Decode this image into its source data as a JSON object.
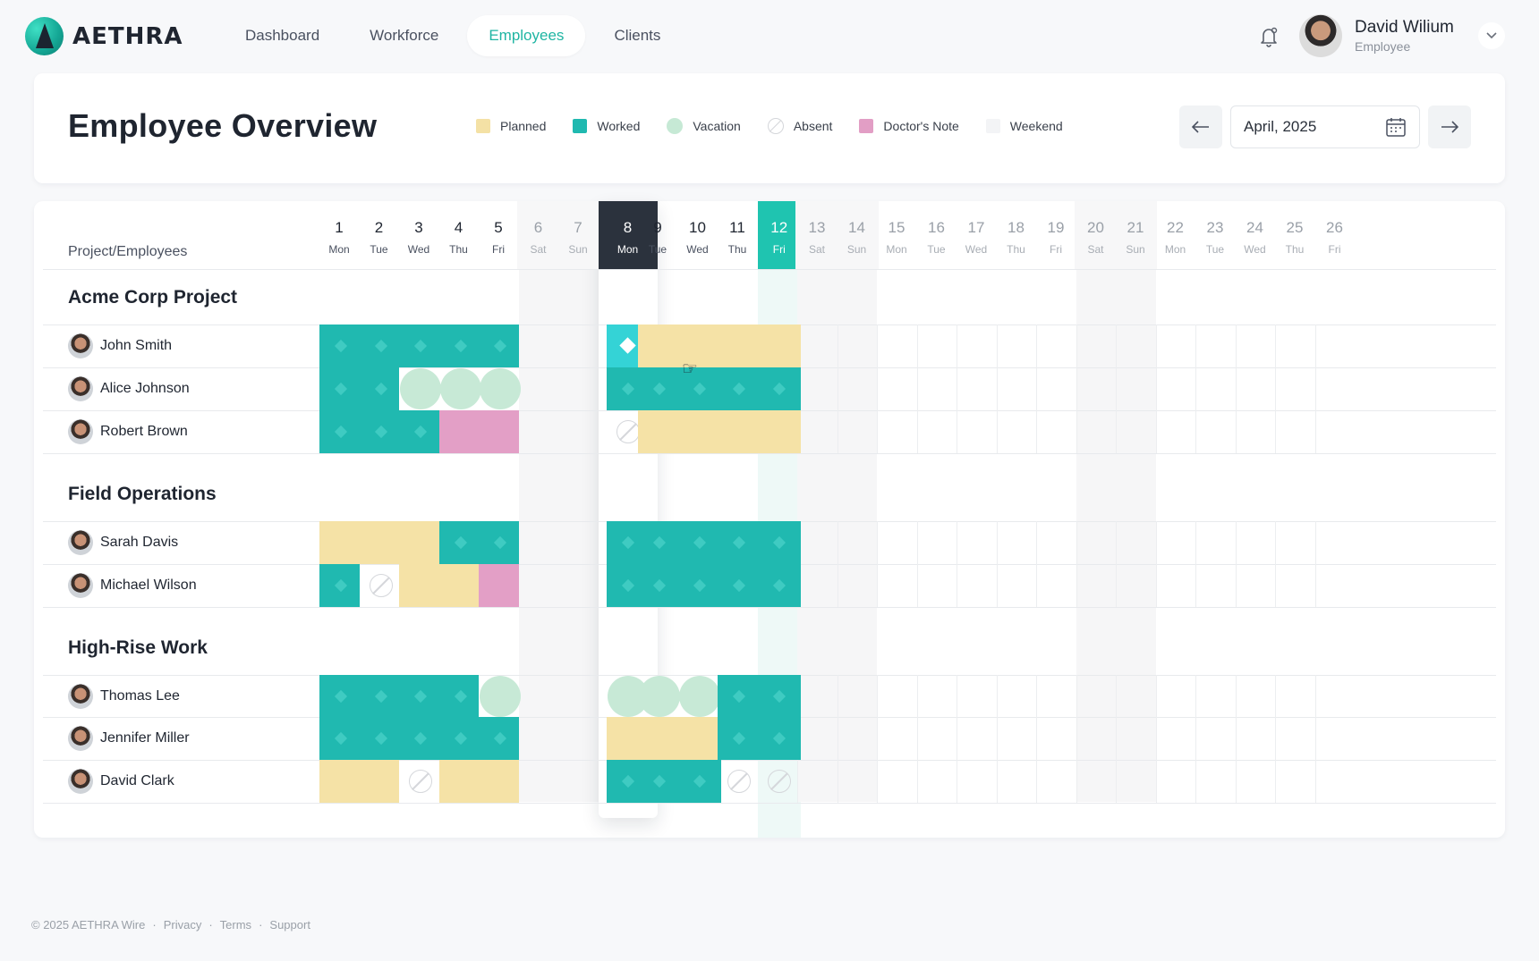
{
  "brand": {
    "name": "AETHRA"
  },
  "nav": [
    {
      "label": "Dashboard",
      "active": false
    },
    {
      "label": "Workforce",
      "active": false
    },
    {
      "label": "Employees",
      "active": true
    },
    {
      "label": "Clients",
      "active": false
    }
  ],
  "user": {
    "name": "David Wilium",
    "role": "Employee"
  },
  "page": {
    "title": "Employee Overview"
  },
  "legend": [
    {
      "key": "planned",
      "label": "Planned",
      "color": "#f4e1a5"
    },
    {
      "key": "worked",
      "label": "Worked",
      "color": "#20b9b0"
    },
    {
      "key": "vacation",
      "label": "Vacation",
      "color": "#c6e9d5"
    },
    {
      "key": "absent",
      "label": "Absent",
      "color": "#d4d6da"
    },
    {
      "key": "doctor",
      "label": "Doctor's Note",
      "color": "#e29ec5"
    },
    {
      "key": "weekend",
      "label": "Weekend",
      "color": "#f3f4f6"
    }
  ],
  "month_picker": {
    "value": "April, 2025"
  },
  "grid": {
    "column_header": "Project/Employees",
    "days": [
      {
        "num": "1",
        "wd": "Mon",
        "weekend": false
      },
      {
        "num": "2",
        "wd": "Tue",
        "weekend": false
      },
      {
        "num": "3",
        "wd": "Wed",
        "weekend": false
      },
      {
        "num": "4",
        "wd": "Thu",
        "weekend": false
      },
      {
        "num": "5",
        "wd": "Fri",
        "weekend": false
      },
      {
        "num": "6",
        "wd": "Sat",
        "weekend": true
      },
      {
        "num": "7",
        "wd": "Sun",
        "weekend": true
      },
      {
        "num": "8",
        "wd": "Mon",
        "weekend": false,
        "selected": true
      },
      {
        "num": "9",
        "wd": "Tue",
        "weekend": false
      },
      {
        "num": "10",
        "wd": "Wed",
        "weekend": false
      },
      {
        "num": "11",
        "wd": "Thu",
        "weekend": false
      },
      {
        "num": "12",
        "wd": "Fri",
        "weekend": false,
        "today": true
      },
      {
        "num": "13",
        "wd": "Sat",
        "weekend": true
      },
      {
        "num": "14",
        "wd": "Sun",
        "weekend": true
      },
      {
        "num": "15",
        "wd": "Mon",
        "weekend": false
      },
      {
        "num": "16",
        "wd": "Tue",
        "weekend": false
      },
      {
        "num": "17",
        "wd": "Wed",
        "weekend": false
      },
      {
        "num": "18",
        "wd": "Thu",
        "weekend": false
      },
      {
        "num": "19",
        "wd": "Fri",
        "weekend": false
      },
      {
        "num": "20",
        "wd": "Sat",
        "weekend": true
      },
      {
        "num": "21",
        "wd": "Sun",
        "weekend": true
      },
      {
        "num": "22",
        "wd": "Mon",
        "weekend": false
      },
      {
        "num": "23",
        "wd": "Tue",
        "weekend": false
      },
      {
        "num": "24",
        "wd": "Wed",
        "weekend": false
      },
      {
        "num": "25",
        "wd": "Thu",
        "weekend": false
      },
      {
        "num": "26",
        "wd": "Fri",
        "weekend": false
      }
    ],
    "projects": [
      {
        "name": "Acme Corp Project",
        "employees": [
          {
            "name": "John Smith",
            "cells": [
              "W",
              "W",
              "W",
              "W",
              "W",
              "",
              "",
              "W*",
              "P",
              "P",
              "P",
              "P"
            ]
          },
          {
            "name": "Alice Johnson",
            "cells": [
              "W",
              "W",
              "V",
              "V",
              "V",
              "",
              "",
              "W",
              "W",
              "W",
              "W",
              "W"
            ]
          },
          {
            "name": "Robert Brown",
            "cells": [
              "W",
              "W",
              "W",
              "D",
              "D",
              "",
              "",
              "A",
              "P",
              "P",
              "P",
              "P"
            ]
          }
        ]
      },
      {
        "name": "Field Operations",
        "employees": [
          {
            "name": "Sarah Davis",
            "cells": [
              "P",
              "P",
              "P",
              "W",
              "W",
              "",
              "",
              "W",
              "W",
              "W",
              "W",
              "W"
            ]
          },
          {
            "name": "Michael Wilson",
            "cells": [
              "W",
              "A",
              "P",
              "P",
              "D",
              "",
              "",
              "W",
              "W",
              "W",
              "W",
              "W"
            ]
          }
        ]
      },
      {
        "name": "High-Rise Work",
        "employees": [
          {
            "name": "Thomas Lee",
            "cells": [
              "W",
              "W",
              "W",
              "W",
              "V",
              "",
              "",
              "V",
              "V",
              "V",
              "W",
              "W"
            ]
          },
          {
            "name": "Jennifer Miller",
            "cells": [
              "W",
              "W",
              "W",
              "W",
              "W",
              "",
              "",
              "P",
              "P",
              "P",
              "W",
              "W"
            ]
          },
          {
            "name": "David Clark",
            "cells": [
              "P",
              "P",
              "A",
              "P",
              "P",
              "",
              "",
              "W",
              "W",
              "W",
              "A",
              "A"
            ]
          }
        ]
      }
    ]
  },
  "footer": {
    "copyright": "© 2025 AETHRA Wire",
    "links": [
      "Privacy",
      "Terms",
      "Support"
    ]
  }
}
